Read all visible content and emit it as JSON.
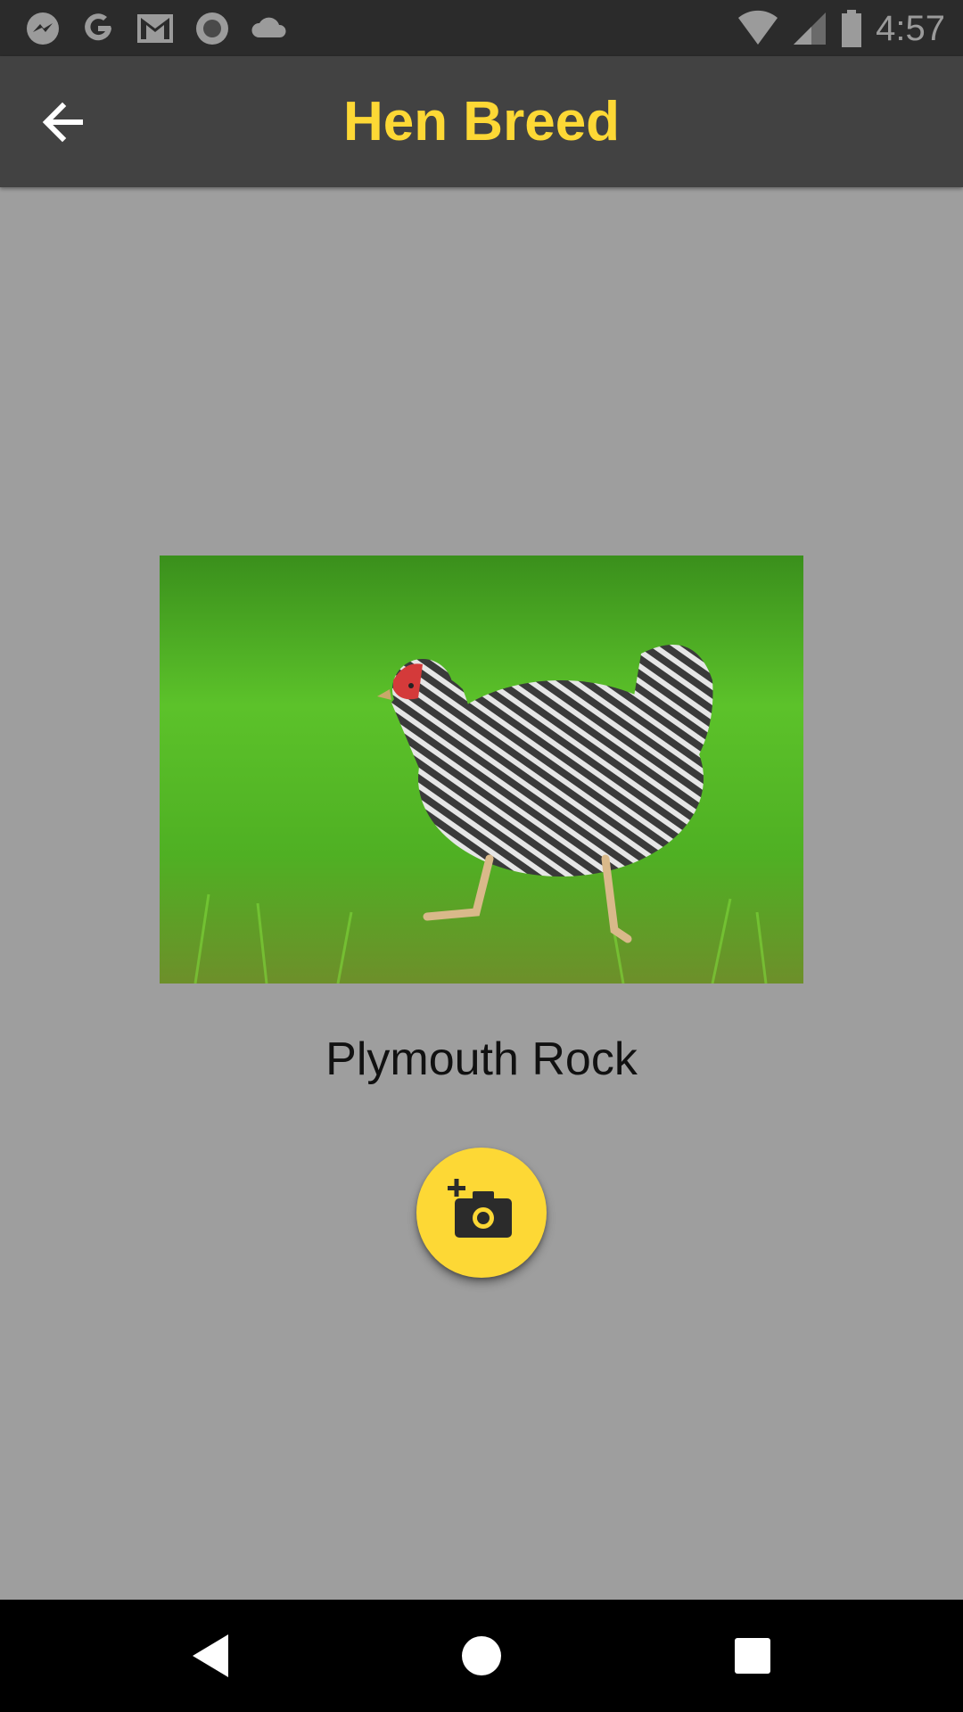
{
  "status_bar": {
    "time": "4:57",
    "left_icons": [
      "messenger-icon",
      "google-icon",
      "gmail-icon",
      "circle-app-icon",
      "cloud-icon"
    ],
    "right_icons": [
      "wifi-icon",
      "cell-signal-icon",
      "battery-icon"
    ]
  },
  "app_bar": {
    "title": "Hen Breed",
    "back_icon": "arrow-left-icon"
  },
  "content": {
    "breed_name": "Plymouth Rock",
    "fab_icon": "add-a-photo-icon"
  },
  "nav_bar": {
    "buttons": [
      "back-triangle-icon",
      "home-circle-icon",
      "recents-square-icon"
    ]
  },
  "colors": {
    "accent": "#fdd835",
    "app_bar": "#424242",
    "status_bar": "#2b2b2b",
    "background": "#9e9e9e",
    "nav_bar": "#000000"
  }
}
